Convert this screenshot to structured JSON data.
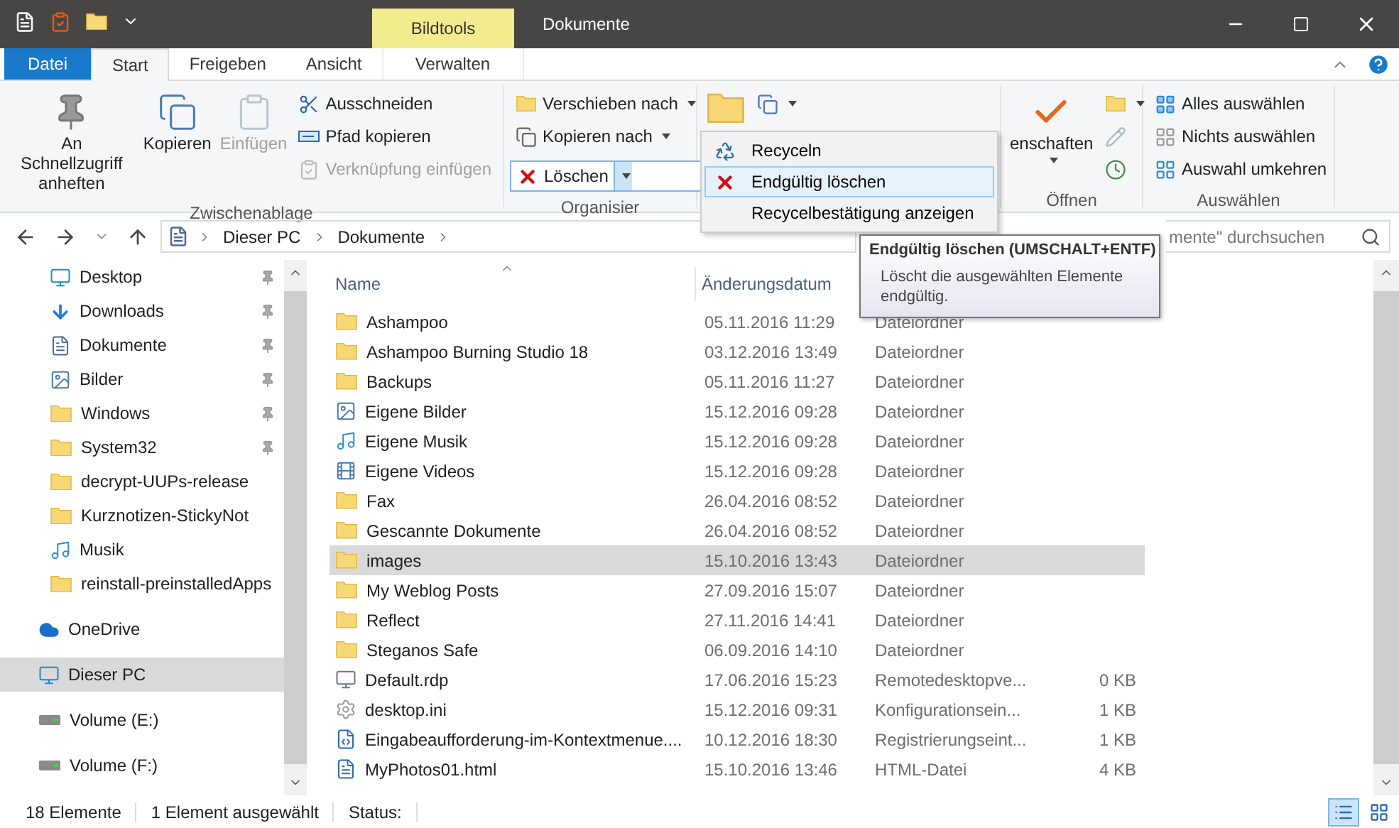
{
  "window": {
    "context_tab": "Bildtools",
    "title": "Dokumente"
  },
  "ribbon_tabs": [
    {
      "label": "Datei",
      "kind": "file",
      "selected": false
    },
    {
      "label": "Start",
      "kind": "tab",
      "selected": true
    },
    {
      "label": "Freigeben",
      "kind": "tab",
      "selected": false
    },
    {
      "label": "Ansicht",
      "kind": "tab",
      "selected": false
    },
    {
      "label": "Verwalten",
      "kind": "context",
      "selected": false
    }
  ],
  "ribbon": {
    "groups": [
      {
        "label": "Zwischenablage",
        "items": [
          {
            "kind": "large",
            "label": "An Schnellzugriff anheften",
            "disabled": false
          },
          {
            "kind": "large",
            "label": "Kopieren",
            "disabled": false
          },
          {
            "kind": "large",
            "label": "Einfügen",
            "disabled": true
          },
          {
            "kind": "small",
            "label": "Ausschneiden",
            "disabled": false
          },
          {
            "kind": "small",
            "label": "Pfad kopieren",
            "disabled": false
          },
          {
            "kind": "small",
            "label": "Verknüpfung einfügen",
            "disabled": true
          }
        ]
      },
      {
        "label": "Organisier",
        "items": [
          {
            "kind": "small",
            "label": "Verschieben nach",
            "dropdown": true,
            "disabled": false
          },
          {
            "kind": "small",
            "label": "Kopieren nach",
            "dropdown": true,
            "disabled": false
          },
          {
            "kind": "split",
            "label": "Löschen",
            "open": true,
            "disabled": false
          }
        ]
      },
      {
        "items": [
          {
            "kind": "large",
            "disabled": false
          },
          {
            "kind": "small",
            "dropdown": true,
            "disabled": false
          }
        ]
      },
      {
        "label": "Öffnen",
        "items": [
          {
            "kind": "large",
            "label": "enschaften",
            "dropdown": true,
            "disabled": false
          },
          {
            "kind": "small",
            "dropdown": true,
            "disabled": false
          },
          {
            "kind": "small",
            "disabled": true
          },
          {
            "kind": "small",
            "disabled": false
          }
        ]
      },
      {
        "label": "Auswählen",
        "items": [
          {
            "kind": "small",
            "label": "Alles auswählen",
            "disabled": false
          },
          {
            "kind": "small",
            "label": "Nichts auswählen",
            "disabled": false
          },
          {
            "kind": "small",
            "label": "Auswahl umkehren",
            "disabled": false
          }
        ]
      }
    ]
  },
  "delete_menu": [
    {
      "label": "Recyceln",
      "selected": false
    },
    {
      "label": "Endgültig löschen",
      "selected": true
    },
    {
      "label": "Recycelbestätigung anzeigen",
      "selected": false
    }
  ],
  "tooltip": {
    "title": "Endgültig löschen (UMSCHALT+ENTF)",
    "text": "Löscht die ausgewählten Elemente endgültig."
  },
  "address": {
    "path": [
      "Dieser PC",
      "Dokumente"
    ]
  },
  "search": {
    "placeholder": "mente\" durchsuchen"
  },
  "sidebar": {
    "quick_access": [
      {
        "kind": "desktop",
        "label": "Desktop",
        "pinned": true
      },
      {
        "kind": "download",
        "label": "Downloads",
        "pinned": true
      },
      {
        "kind": "documents",
        "label": "Dokumente",
        "pinned": true
      },
      {
        "kind": "pictures",
        "label": "Bilder",
        "pinned": true
      },
      {
        "kind": "folder",
        "label": "Windows",
        "pinned": true
      },
      {
        "kind": "folder",
        "label": "System32",
        "pinned": true
      },
      {
        "kind": "folder",
        "label": "decrypt-UUPs-release",
        "pinned": false
      },
      {
        "kind": "folder",
        "label": "Kurznotizen-StickyNot",
        "pinned": false
      },
      {
        "kind": "music",
        "label": "Musik",
        "pinned": false
      },
      {
        "kind": "folder",
        "label": "reinstall-preinstalledApps",
        "pinned": false
      }
    ],
    "locations": [
      {
        "kind": "onedrive",
        "label": "OneDrive",
        "selected": false
      },
      {
        "kind": "pc",
        "label": "Dieser PC",
        "selected": true
      },
      {
        "kind": "drive",
        "label": "Volume (E:)",
        "selected": false
      },
      {
        "kind": "drive",
        "label": "Volume (F:)",
        "selected": false
      }
    ]
  },
  "table": {
    "columns": [
      "Name",
      "Änderungsdatum"
    ],
    "rows": [
      {
        "kind": "folder",
        "name": "Ashampoo",
        "date": "05.11.2016 11:29",
        "type": "Dateiordner",
        "selected": false
      },
      {
        "kind": "folder",
        "name": "Ashampoo Burning Studio 18",
        "date": "03.12.2016 13:49",
        "type": "Dateiordner",
        "selected": false
      },
      {
        "kind": "folder",
        "name": "Backups",
        "date": "05.11.2016 11:27",
        "type": "Dateiordner",
        "selected": false
      },
      {
        "kind": "pictures",
        "name": "Eigene Bilder",
        "date": "15.12.2016 09:28",
        "type": "Dateiordner",
        "selected": false
      },
      {
        "kind": "music",
        "name": "Eigene Musik",
        "date": "15.12.2016 09:28",
        "type": "Dateiordner",
        "selected": false
      },
      {
        "kind": "videos",
        "name": "Eigene Videos",
        "date": "15.12.2016 09:28",
        "type": "Dateiordner",
        "selected": false
      },
      {
        "kind": "folder",
        "name": "Fax",
        "date": "26.04.2016 08:52",
        "type": "Dateiordner",
        "selected": false
      },
      {
        "kind": "folder",
        "name": "Gescannte Dokumente",
        "date": "26.04.2016 08:52",
        "type": "Dateiordner",
        "selected": false
      },
      {
        "kind": "folder",
        "name": "images",
        "date": "15.10.2016 13:43",
        "type": "Dateiordner",
        "selected": true
      },
      {
        "kind": "folder",
        "name": "My Weblog Posts",
        "date": "27.09.2016 15:07",
        "type": "Dateiordner",
        "selected": false
      },
      {
        "kind": "folder",
        "name": "Reflect",
        "date": "27.11.2016 14:41",
        "type": "Dateiordner",
        "selected": false
      },
      {
        "kind": "folder",
        "name": "Steganos Safe",
        "date": "06.09.2016 14:10",
        "type": "Dateiordner",
        "selected": false
      },
      {
        "kind": "rdp",
        "name": "Default.rdp",
        "date": "17.06.2016 15:23",
        "type": "Remotedesktopve...",
        "size": "0 KB",
        "selected": false
      },
      {
        "kind": "ini",
        "name": "desktop.ini",
        "date": "15.12.2016 09:31",
        "type": "Konfigurationsein...",
        "size": "1 KB",
        "selected": false
      },
      {
        "kind": "reg",
        "name": "Eingabeaufforderung-im-Kontextmenue....",
        "date": "10.12.2016 18:30",
        "type": "Registrierungseint...",
        "size": "1 KB",
        "selected": false
      },
      {
        "kind": "html",
        "name": "MyPhotos01.html",
        "date": "15.10.2016 13:46",
        "type": "HTML-Datei",
        "size": "4 KB",
        "selected": false
      }
    ]
  },
  "status_bar": {
    "count": "18 Elemente",
    "selection": "1 Element ausgewählt",
    "status": "Status:",
    "views": [
      {
        "kind": "details",
        "selected": true
      },
      {
        "kind": "tiles",
        "selected": false
      }
    ]
  }
}
